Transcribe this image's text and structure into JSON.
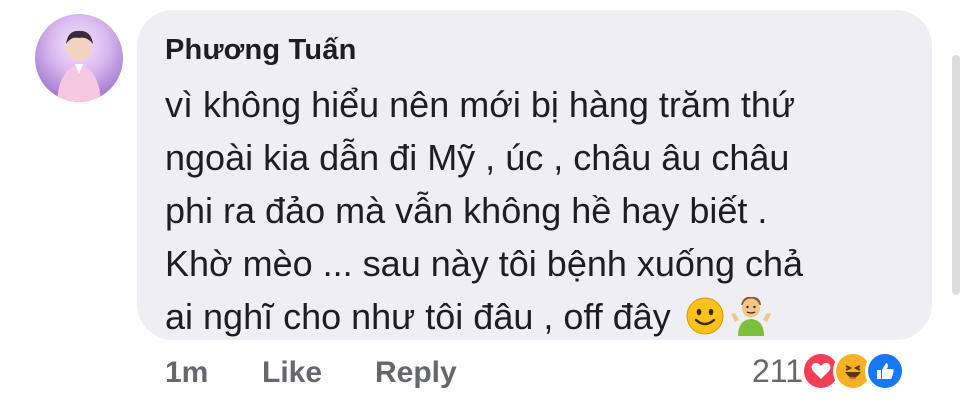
{
  "comment": {
    "author": "Phương Tuấn",
    "lines": [
      "vì không hiểu nên mới bị hàng trăm thứ",
      "ngoài kia dẫn đi Mỹ , úc , châu âu châu",
      "phi ra đảo mà vẫn không hề hay biết .",
      "Khờ mèo ... sau này tôi bệnh xuống chả",
      "ai nghĩ cho như tôi đâu , off đây"
    ],
    "emojis": [
      "slightly-smiling-face-icon",
      "person-shrugging-icon"
    ]
  },
  "meta": {
    "time": "1m",
    "like_label": "Like",
    "reply_label": "Reply"
  },
  "reactions": {
    "count": "211",
    "icons": [
      "love-icon",
      "haha-icon",
      "like-icon"
    ]
  },
  "colors": {
    "bubble": "#efeff3",
    "text": "#1c1e21",
    "meta_text": "#65676b",
    "love": "#f33e58",
    "haha": "#f7b125",
    "like": "#1877f2"
  }
}
